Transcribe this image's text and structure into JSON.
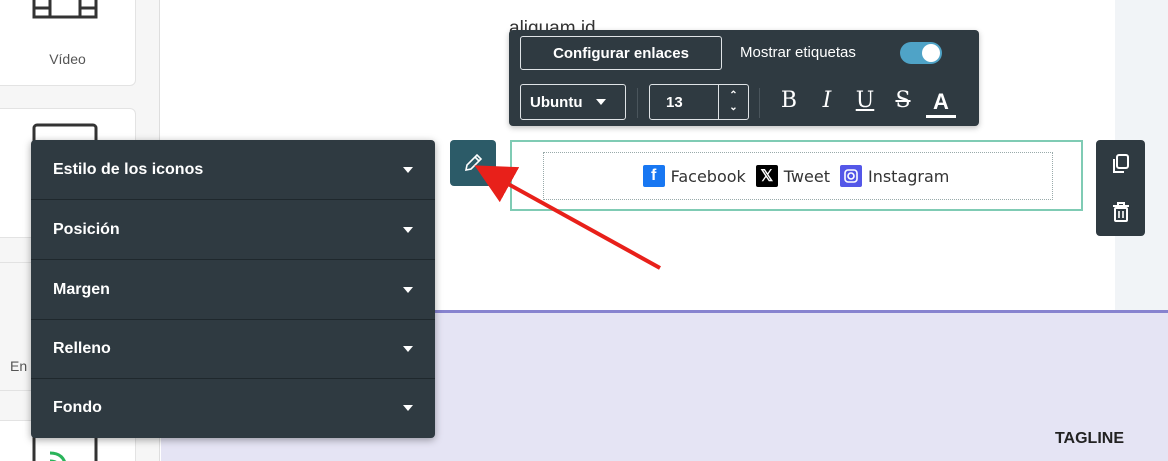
{
  "sidebar": {
    "video_label": "Vídeo",
    "partial_label": "En"
  },
  "canvas": {
    "cut_text": "aliquam id",
    "tagline": "TAGLINE"
  },
  "toolbar": {
    "configure_links": "Configurar enlaces",
    "show_labels": "Mostrar etiquetas",
    "show_labels_on": true,
    "font": "Ubuntu",
    "font_size": "13",
    "bold": "B",
    "italic": "I",
    "underline": "U",
    "strike": "S",
    "color": "A"
  },
  "social": {
    "items": [
      {
        "label": "Facebook",
        "icon": "facebook-icon",
        "color": "#1877f2"
      },
      {
        "label": "Tweet",
        "icon": "x-icon",
        "color": "#000000"
      },
      {
        "label": "Instagram",
        "icon": "instagram-icon",
        "color": "#5457e8"
      }
    ]
  },
  "settings": {
    "sections": [
      {
        "label": "Estilo de los iconos"
      },
      {
        "label": "Posición"
      },
      {
        "label": "Margen"
      },
      {
        "label": "Relleno"
      },
      {
        "label": "Fondo"
      }
    ]
  },
  "colors": {
    "panel_bg": "#2f3a41",
    "accent": "#4fa3c7",
    "selection_border": "#7fcbb4",
    "band_bg": "#e5e4f4",
    "arrow": "#e8201a"
  }
}
